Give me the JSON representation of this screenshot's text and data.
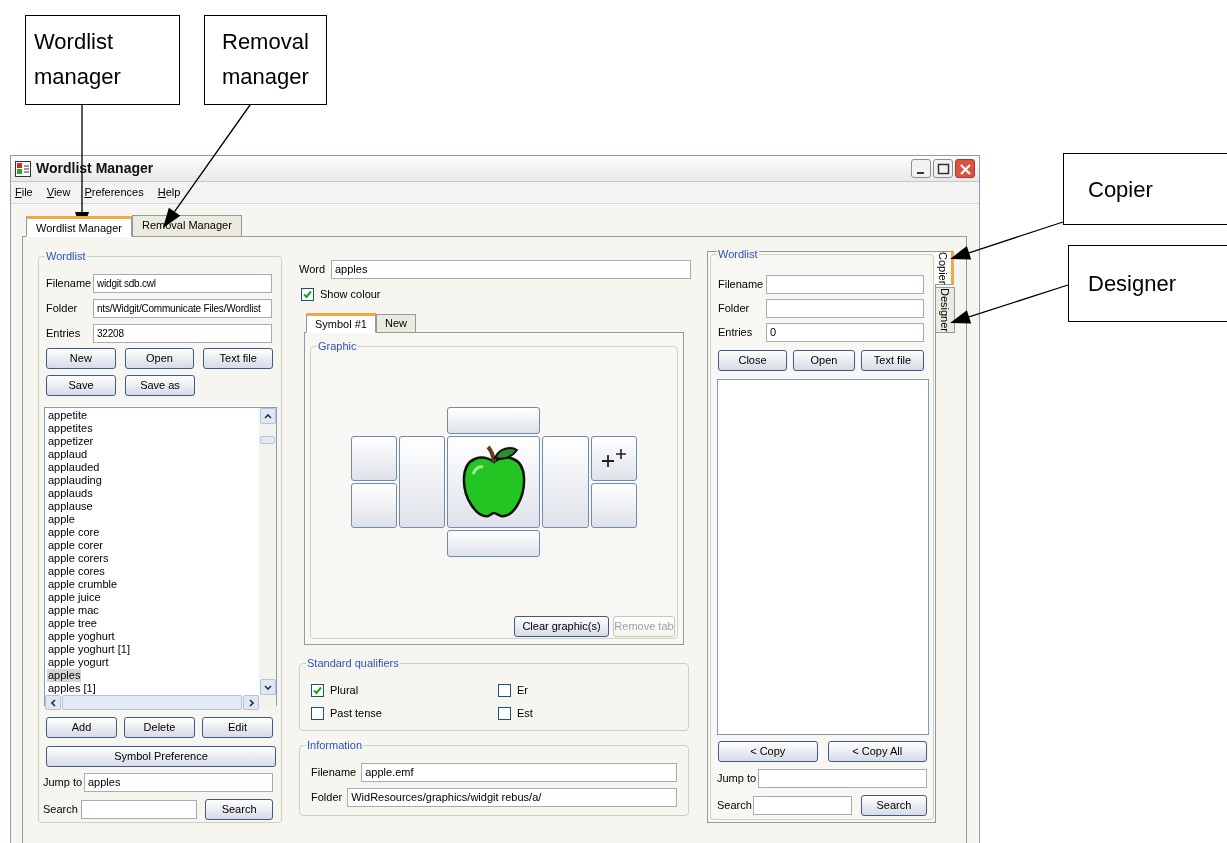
{
  "callouts": [
    {
      "text": "Wordlist manager"
    },
    {
      "text": "Removal manager"
    },
    {
      "text": "Copier"
    },
    {
      "text": "Designer"
    }
  ],
  "window": {
    "title": "Wordlist Manager"
  },
  "menu": [
    {
      "label": "File"
    },
    {
      "label": "View"
    },
    {
      "label": "Preferences"
    },
    {
      "label": "Help"
    }
  ],
  "tabs": [
    {
      "label": "Wordlist Manager",
      "selected": true
    },
    {
      "label": "Removal Manager",
      "selected": false
    }
  ],
  "wordlist": {
    "legend": "Wordlist",
    "fields": [
      {
        "label": "Filename",
        "value": "widgit sdb.cwl"
      },
      {
        "label": "Folder",
        "value": "nts/Widgit/Communicate Files/Wordlist"
      },
      {
        "label": "Entries",
        "value": "32208"
      }
    ],
    "buttons": [
      "New",
      "Open",
      "Text file"
    ],
    "buttons_row2": [
      "Save",
      "Save as"
    ],
    "list": [
      {
        "text": "appetite",
        "selected": false
      },
      {
        "text": "appetites",
        "selected": false
      },
      {
        "text": "appetizer",
        "selected": false
      },
      {
        "text": "applaud",
        "selected": false
      },
      {
        "text": "applauded",
        "selected": false
      },
      {
        "text": "applauding",
        "selected": false
      },
      {
        "text": "applauds",
        "selected": false
      },
      {
        "text": "applause",
        "selected": false
      },
      {
        "text": "apple",
        "selected": false
      },
      {
        "text": "apple core",
        "selected": false
      },
      {
        "text": "apple corer",
        "selected": false
      },
      {
        "text": "apple corers",
        "selected": false
      },
      {
        "text": "apple cores",
        "selected": false
      },
      {
        "text": "apple crumble",
        "selected": false
      },
      {
        "text": "apple juice",
        "selected": false
      },
      {
        "text": "apple mac",
        "selected": false
      },
      {
        "text": "apple tree",
        "selected": false
      },
      {
        "text": "apple yoghurt",
        "selected": false
      },
      {
        "text": "apple yoghurt [1]",
        "selected": false
      },
      {
        "text": "apple yogurt",
        "selected": false
      },
      {
        "text": "apples",
        "selected": true
      },
      {
        "text": "apples [1]",
        "selected": false
      }
    ],
    "action_buttons": [
      "Add",
      "Delete",
      "Edit"
    ],
    "symbol_button": "Symbol Preference",
    "jump_to": {
      "label": "Jump to",
      "value": "apples"
    },
    "search": {
      "label": "Search",
      "button": "Search"
    }
  },
  "editor": {
    "word": {
      "label": "Word",
      "value": "apples"
    },
    "show_colour": {
      "label": "Show colour",
      "checked": true
    },
    "symbol_tabs": [
      {
        "label": "Symbol #1",
        "selected": true
      },
      {
        "label": "New",
        "selected": false
      }
    ],
    "graphic": {
      "legend": "Graphic",
      "buttons": [
        {
          "label": "Clear graphic(s)",
          "disabled": false
        },
        {
          "label": "Remove tab",
          "disabled": true
        }
      ]
    },
    "qualifiers": {
      "legend": "Standard qualifiers",
      "items": [
        {
          "label": "Plural",
          "checked": true
        },
        {
          "label": "Er",
          "checked": false
        },
        {
          "label": "Past tense",
          "checked": false
        },
        {
          "label": "Est",
          "checked": false
        }
      ]
    },
    "information": {
      "legend": "Information",
      "fields": [
        {
          "label": "Filename",
          "value": "apple.emf"
        },
        {
          "label": "Folder",
          "value": "WidResources/graphics/widgit rebus/a/"
        }
      ]
    }
  },
  "copier": {
    "legend": "Wordlist",
    "fields": [
      {
        "label": "Filename"
      },
      {
        "label": "Folder"
      },
      {
        "label": "Entries",
        "value": "0"
      }
    ],
    "buttons": [
      "Close",
      "Open",
      "Text file"
    ],
    "copy_buttons": [
      "< Copy",
      "< Copy All"
    ],
    "jump_to": {
      "label": "Jump to"
    },
    "search": {
      "label": "Search",
      "button": "Search"
    }
  },
  "side_tabs": [
    {
      "label": "Copier",
      "selected": true
    },
    {
      "label": "Designer",
      "selected": false
    }
  ]
}
